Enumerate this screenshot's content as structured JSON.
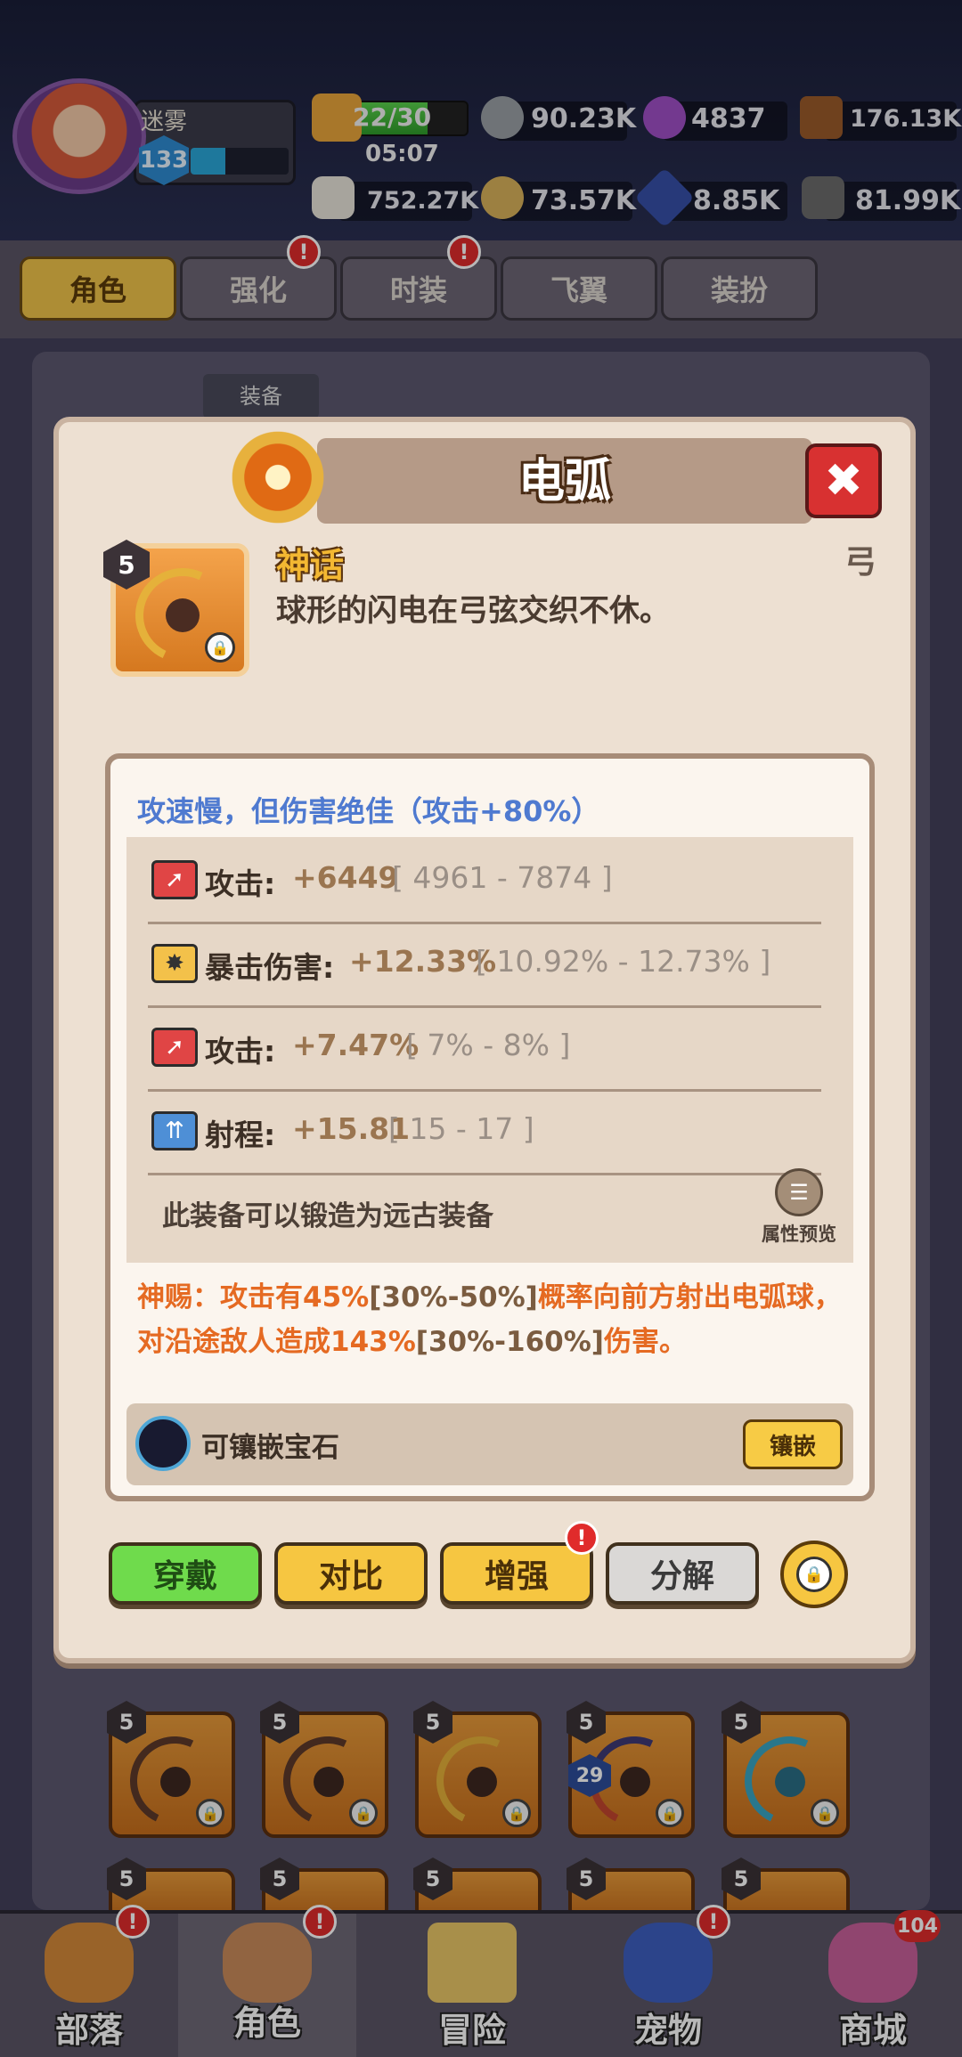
{
  "player": {
    "name": "迷雾",
    "level": "133",
    "xp_fraction": 0.35
  },
  "resources": {
    "energy": {
      "text": "22/30",
      "timer": "05:07",
      "fraction": 0.73
    },
    "row1": [
      {
        "icon": "gray-ore-icon",
        "value": "90.23K"
      },
      {
        "icon": "purple-orb-icon",
        "value": "4837"
      },
      {
        "icon": "wood-log-icon",
        "value": "176.13K"
      }
    ],
    "row2": [
      {
        "icon": "bone-icon",
        "value": "752.27K"
      },
      {
        "icon": "gold-ore-icon",
        "value": "73.57K"
      },
      {
        "icon": "blue-crystal-icon",
        "value": "8.85K"
      },
      {
        "icon": "stone-icon",
        "value": "81.99K"
      }
    ]
  },
  "tabs": [
    {
      "label": "角色",
      "active": true,
      "alert": false
    },
    {
      "label": "强化",
      "active": false,
      "alert": true
    },
    {
      "label": "时装",
      "active": false,
      "alert": true
    },
    {
      "label": "飞翼",
      "active": false,
      "alert": false
    },
    {
      "label": "装扮",
      "active": false,
      "alert": false
    }
  ],
  "background": {
    "equip_label": "装备",
    "slot_level": "5",
    "badge_level": "29"
  },
  "modal": {
    "title": "电弧",
    "rarity": "神话",
    "description": "球形的闪电在弓弦交织不休。",
    "weapon_type": "弓",
    "item_level": "5",
    "stat_header": "攻速慢，但伤害绝佳（攻击+80%）",
    "stats": [
      {
        "icon": "attack-icon",
        "label": "攻击:",
        "value": "+6449",
        "range": "[ 4961 - 7874 ]"
      },
      {
        "icon": "crit-damage-icon",
        "label": "暴击伤害:",
        "value": "+12.33%",
        "range": "[ 10.92% - 12.73% ]"
      },
      {
        "icon": "attack-icon",
        "label": "攻击:",
        "value": "+7.47%",
        "range": "[ 7% - 8% ]"
      },
      {
        "icon": "range-icon",
        "label": "射程:",
        "value": "+15.81",
        "range": "[ 15 - 17 ]"
      }
    ],
    "forge_note": "此装备可以锻造为远古装备",
    "preview_label": "属性预览",
    "divine": {
      "p1": "神赐：攻击有45%",
      "r1": "[30%-50%]",
      "p2": "概率向前方射出电弧球，对沿途敌人造成143%",
      "r2": "[30%-160%]",
      "p3": "伤害。"
    },
    "gem_label": "可镶嵌宝石",
    "inlay_button": "镶嵌",
    "actions": {
      "wear": "穿戴",
      "compare": "对比",
      "enhance": "增强",
      "dismantle": "分解"
    },
    "alert_mark": "!"
  },
  "bottom_nav": [
    {
      "label": "部落",
      "alert": true
    },
    {
      "label": "角色",
      "alert": true,
      "active": true
    },
    {
      "label": "冒险",
      "alert": false
    },
    {
      "label": "宠物",
      "alert": true
    },
    {
      "label": "商城",
      "badge": "104"
    }
  ],
  "colors": {
    "accent_yellow": "#f6c641",
    "button_green": "#6fdb4c",
    "stat_header_blue": "#4f7ad0",
    "divine_orange": "#e56a22",
    "close_red": "#d83131"
  }
}
